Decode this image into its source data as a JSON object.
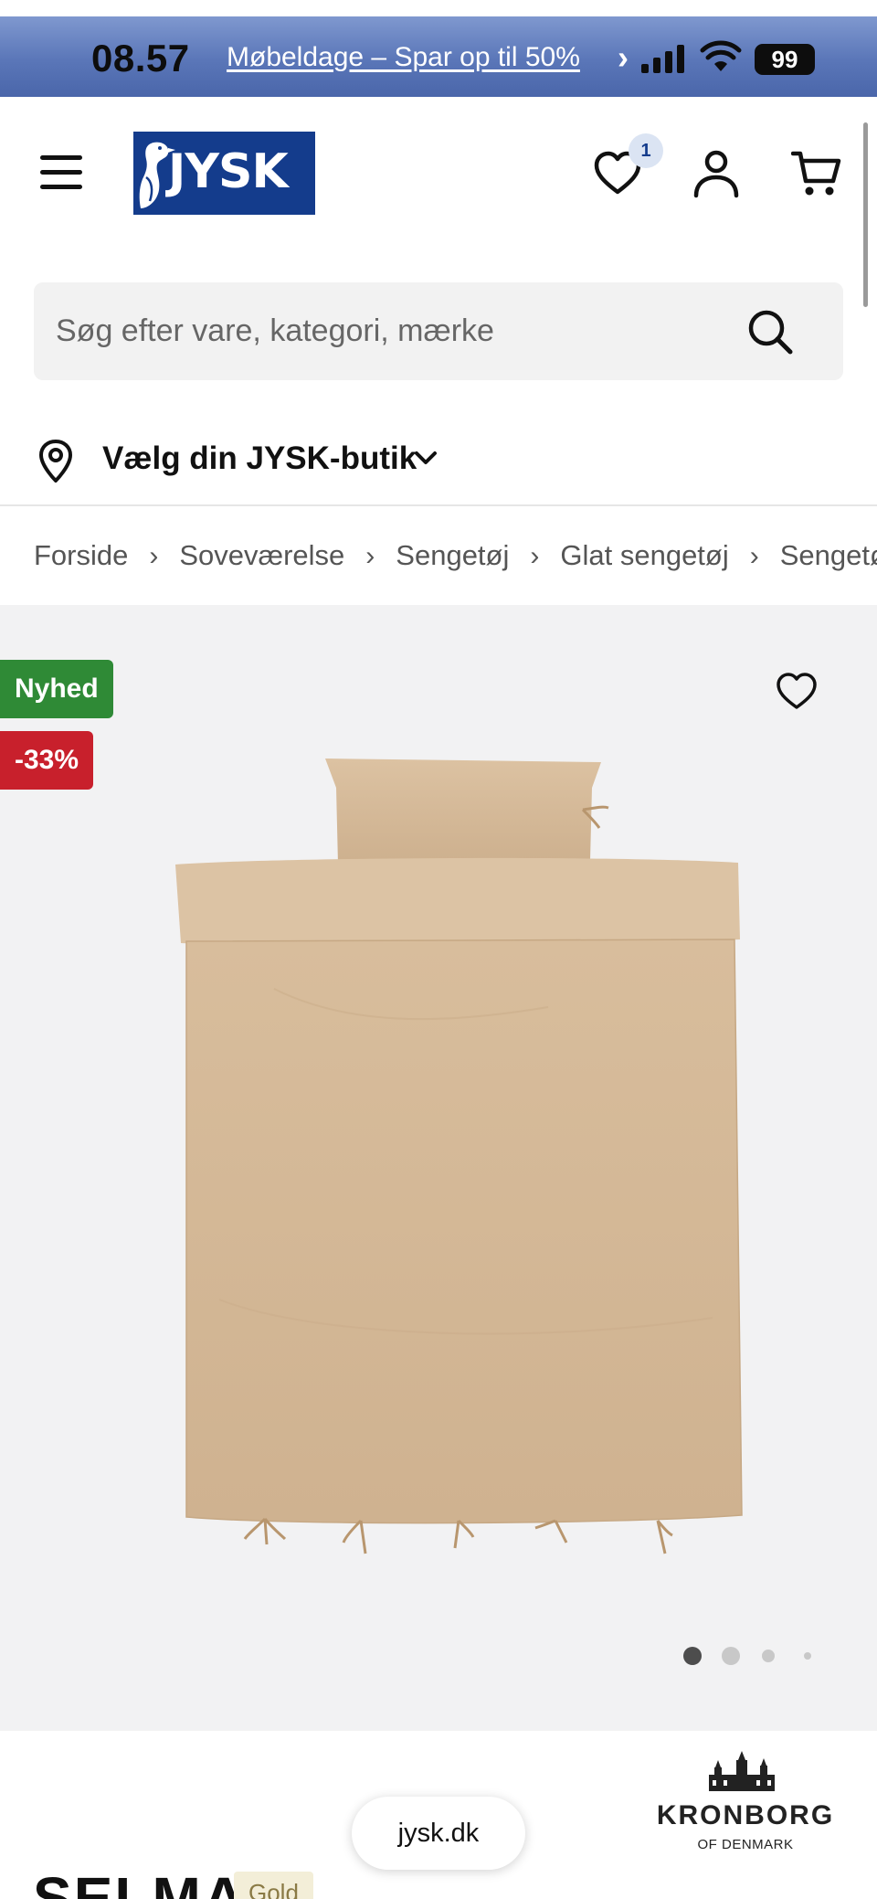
{
  "status_bar": {
    "time": "08.57",
    "promo_link": "Møbeldage – Spar op til 50%",
    "battery": "99"
  },
  "header": {
    "logo_text": "JYSK",
    "wishlist_count": "1"
  },
  "search": {
    "placeholder": "Søg efter vare, kategori, mærke"
  },
  "store_selector": {
    "label": "Vælg din JYSK-butik"
  },
  "breadcrumb": [
    "Forside",
    "Soveværelse",
    "Sengetøj",
    "Glat sengetøj",
    "Sengetøj"
  ],
  "product": {
    "badges": {
      "new": "Nyhed",
      "discount": "-33%"
    },
    "image_count": 4,
    "active_image_index": 0,
    "brand": {
      "name": "KRONBORG",
      "sub": "OF DENMARK"
    },
    "title": "SELMA",
    "colour": "Gold"
  },
  "browser": {
    "url": "jysk.dk"
  },
  "colors": {
    "brand_blue": "#143c8c",
    "new_badge": "#2f8a36",
    "discount_badge": "#c8202c",
    "gallery_bg": "#f2f2f3",
    "product_beige": "#d5b898"
  }
}
